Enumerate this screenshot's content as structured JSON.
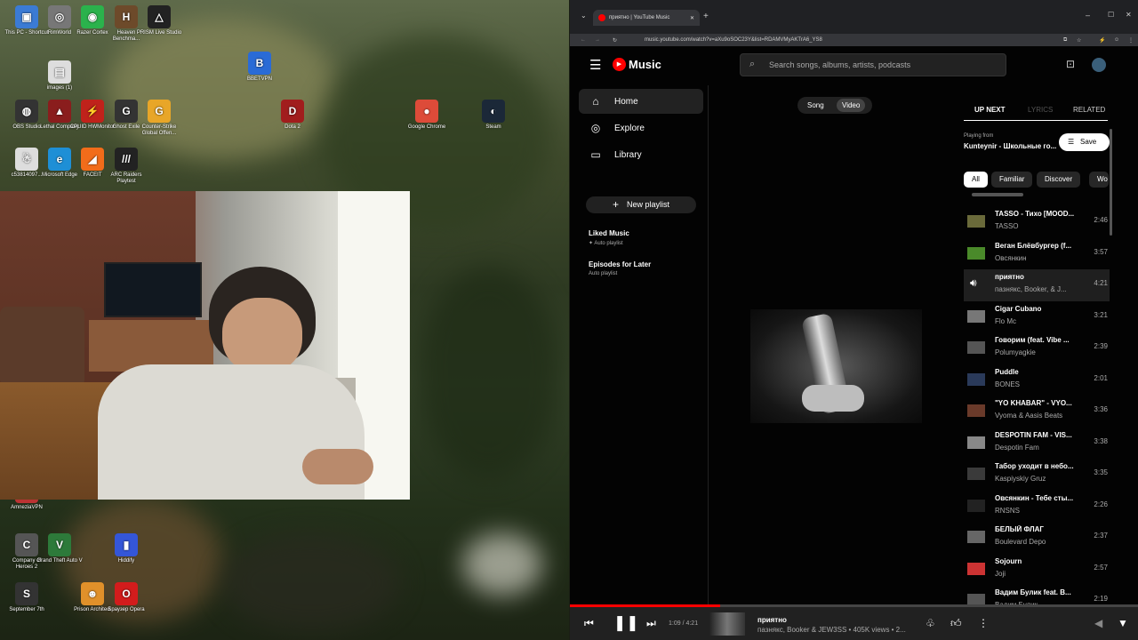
{
  "desktop_icons": [
    {
      "name": "this-pc-shortcut",
      "label": "This PC - Shortcut",
      "glyph": "▣",
      "color": "#3b7bd4"
    },
    {
      "name": "rimworld",
      "label": "RimWorld",
      "glyph": "◎",
      "color": "#777"
    },
    {
      "name": "razer-cortex",
      "label": "Razer Cortex",
      "glyph": "◉",
      "color": "#2bb24c"
    },
    {
      "name": "heaven-benchmark",
      "label": "Heaven Benchma...",
      "glyph": "H",
      "color": "#6d4a2a"
    },
    {
      "name": "prism-live-studio",
      "label": "PRISM Live Studio",
      "glyph": "△",
      "color": "#222"
    },
    {
      "name": "images",
      "label": "images (1)",
      "glyph": "▤",
      "color": "#ddd"
    },
    {
      "name": "betvpn",
      "label": "BBETVPN",
      "glyph": "B",
      "color": "#2a6bd6"
    },
    {
      "name": "obs-studio",
      "label": "OBS Studio",
      "glyph": "◍",
      "color": "#333"
    },
    {
      "name": "lethal-company",
      "label": "Lethal Company",
      "glyph": "▲",
      "color": "#8a1d1d"
    },
    {
      "name": "cpuid-hwmonitor",
      "label": "CPUID HWMonitor",
      "glyph": "⚡",
      "color": "#c0221b"
    },
    {
      "name": "ghost-exile",
      "label": "Ghost Exile",
      "glyph": "G",
      "color": "#333"
    },
    {
      "name": "counter-strike",
      "label": "Counter-Strike Global Offen...",
      "glyph": "G",
      "color": "#e8a628"
    },
    {
      "name": "dota2",
      "label": "Dota 2",
      "glyph": "D",
      "color": "#a11d1d"
    },
    {
      "name": "google-chrome",
      "label": "Google Chrome",
      "glyph": "●",
      "color": "#dd4b39"
    },
    {
      "name": "steam",
      "label": "Steam",
      "glyph": "◐",
      "color": "#1b2838"
    },
    {
      "name": "c538",
      "label": "c53814097...",
      "glyph": "☃",
      "color": "#ddd"
    },
    {
      "name": "microsoft-edge",
      "label": "Microsoft Edge",
      "glyph": "e",
      "color": "#1e8fd6"
    },
    {
      "name": "faceit",
      "label": "FACEIT",
      "glyph": "◢",
      "color": "#f26c1a"
    },
    {
      "name": "arc-raiders",
      "label": "ARC Raiders Playtest",
      "glyph": "///",
      "color": "#222"
    },
    {
      "name": "amnezia-vpn",
      "label": "AmneziaVPN",
      "glyph": "A",
      "color": "#b33"
    },
    {
      "name": "company-of-heroes",
      "label": "Company of Heroes 2",
      "glyph": "C",
      "color": "#555"
    },
    {
      "name": "gta5",
      "label": "Grand Theft Auto V",
      "glyph": "V",
      "color": "#2d7a3a"
    },
    {
      "name": "hiddify",
      "label": "Hiddify",
      "glyph": "▮",
      "color": "#3456d8"
    },
    {
      "name": "september-7th",
      "label": "September 7th",
      "glyph": "S",
      "color": "#333"
    },
    {
      "name": "prison-architect",
      "label": "Prison Architect",
      "glyph": "☻",
      "color": "#e0902a"
    },
    {
      "name": "opera",
      "label": "Браузер Opera",
      "glyph": "O",
      "color": "#d31c1c"
    }
  ],
  "browser": {
    "tab_title": "приятно | YouTube Music",
    "url": "music.youtube.com/watch?v=aXu9oSOC23Y&list=RDAMVMyAKTrA6_YS8"
  },
  "yt": {
    "logo": "Music",
    "search_placeholder": "Search songs, albums, artists, podcasts",
    "nav": [
      {
        "label": "Home",
        "icon": "⌂"
      },
      {
        "label": "Explore",
        "icon": "◎"
      },
      {
        "label": "Library",
        "icon": "▭"
      }
    ],
    "new_playlist": "New playlist",
    "playlists": [
      {
        "title": "Liked Music",
        "sub": "Auto playlist",
        "pin": true
      },
      {
        "title": "Episodes for Later",
        "sub": "Auto playlist",
        "pin": false
      }
    ],
    "toggle": [
      "Song",
      "Video"
    ],
    "tabs": [
      "UP NEXT",
      "LYRICS",
      "RELATED"
    ],
    "playing_from_label": "Playing from",
    "playing_from": "Kunteynir - Школьные го...",
    "save": "Save",
    "chips": [
      "All",
      "Familiar",
      "Discover",
      "Wo"
    ],
    "queue": [
      {
        "title": "TASSO - Тихо [MOOD...",
        "artist": "TASSO",
        "dur": "2:46"
      },
      {
        "title": "Веган Блёвбургер (f...",
        "artist": "Овсянкин",
        "dur": "3:57"
      },
      {
        "title": "приятно",
        "artist": "пазнякс, Booker, & J...",
        "dur": "4:21",
        "playing": true
      },
      {
        "title": "Cigar Cubano",
        "artist": "Flo Mc",
        "dur": "3:21"
      },
      {
        "title": "Говорим (feat. Vibe ...",
        "artist": "Polumyagkie",
        "dur": "2:39"
      },
      {
        "title": "Puddle",
        "artist": "BONES",
        "dur": "2:01"
      },
      {
        "title": "\"YO KHABAR\" - VYO...",
        "artist": "Vyoma & Aasis Beats",
        "dur": "3:36"
      },
      {
        "title": "DESPOTIN FAM - VIS...",
        "artist": "Despotin Fam",
        "dur": "3:38"
      },
      {
        "title": "Табор уходит в небо...",
        "artist": "Kaspiyskiy Gruz",
        "dur": "3:35"
      },
      {
        "title": "Овсянкин - Тебе сты...",
        "artist": "RNSNS",
        "dur": "2:26"
      },
      {
        "title": "БЕЛЫЙ ФЛАГ",
        "artist": "Boulevard Depo",
        "dur": "2:37"
      },
      {
        "title": "Sojourn",
        "artist": "Joji",
        "dur": "2:57"
      },
      {
        "title": "Вадим Булик feat. В...",
        "artist": "Вадим Булик",
        "dur": "2:19"
      }
    ],
    "player": {
      "time": "1:09 / 4:21",
      "progress": 0.264,
      "title": "приятно",
      "subtitle": "пазнякс, Booker & JEW3SS • 405K views • 2..."
    }
  }
}
